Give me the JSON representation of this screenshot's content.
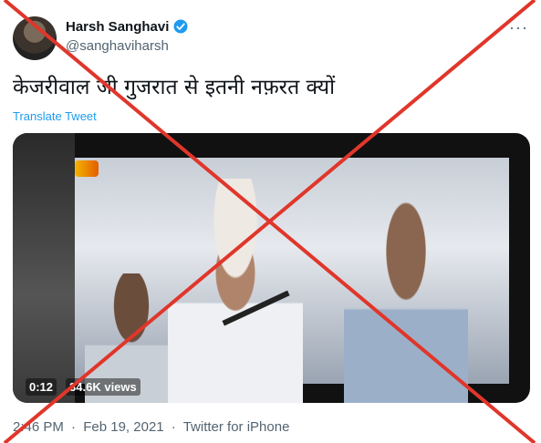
{
  "user": {
    "name": "Harsh Sanghavi",
    "handle": "@sanghaviharsh",
    "verified_icon": "verified-badge-icon"
  },
  "menu_icon": "more-options-icon",
  "tweet": {
    "text": "केजरीवाल जी गुजरात से इतनी नफ़रत क्यों",
    "translate_label": "Translate Tweet"
  },
  "video": {
    "duration": "0:12",
    "views": "34.6K views"
  },
  "meta": {
    "time": "2:46 PM",
    "date": "Feb 19, 2021",
    "source": "Twitter for iPhone"
  },
  "overlay": {
    "cross_color": "#e0362b"
  }
}
